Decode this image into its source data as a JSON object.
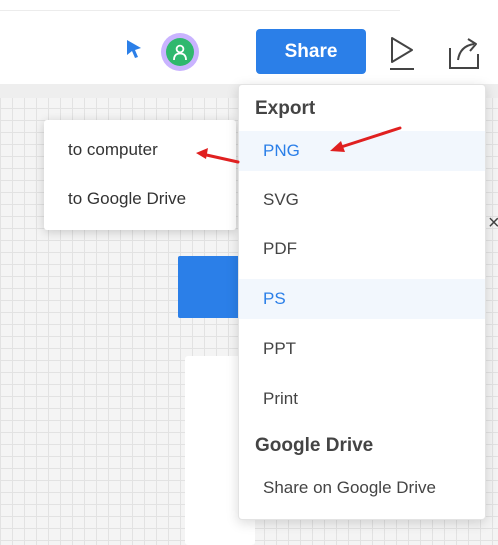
{
  "toolbar": {
    "share_label": "Share",
    "icons": [
      "cursor-icon",
      "user-avatar-icon",
      "play-icon",
      "export-icon"
    ]
  },
  "export_menu": {
    "export_heading": "Export",
    "export_items": [
      "PNG",
      "SVG",
      "PDF",
      "PS",
      "PPT",
      "Print"
    ],
    "gdrive_heading": "Google Drive",
    "gdrive_items": [
      "Share on Google Drive"
    ]
  },
  "submenu": {
    "items": [
      "to computer",
      "to Google Drive"
    ]
  },
  "colors": {
    "accent": "#2b7fe8",
    "highlight_bg": "#f2f7fd",
    "annotation_arrow": "#e02020",
    "avatar_ring": "#c9b3ff",
    "avatar_fill": "#2fb86e"
  }
}
